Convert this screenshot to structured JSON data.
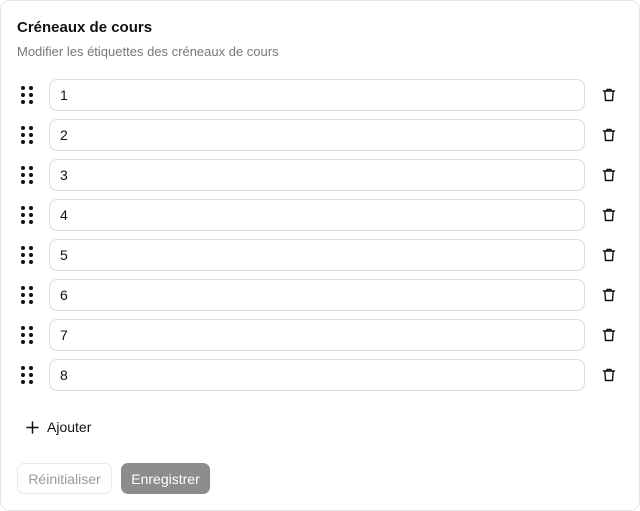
{
  "header": {
    "title": "Créneaux de cours",
    "subtitle": "Modifier les étiquettes des créneaux de cours"
  },
  "slots": [
    {
      "value": "1"
    },
    {
      "value": "2"
    },
    {
      "value": "3"
    },
    {
      "value": "4"
    },
    {
      "value": "5"
    },
    {
      "value": "6"
    },
    {
      "value": "7"
    },
    {
      "value": "8"
    }
  ],
  "actions": {
    "add_label": "Ajouter",
    "reset_label": "Réinitialiser",
    "save_label": "Enregistrer"
  },
  "icons": {
    "drag": "drag-handle-icon",
    "delete": "trash-icon",
    "add": "plus-icon"
  },
  "colors": {
    "save_button": "#8c8c8c",
    "border": "#dddddd",
    "muted_text": "#777777"
  }
}
